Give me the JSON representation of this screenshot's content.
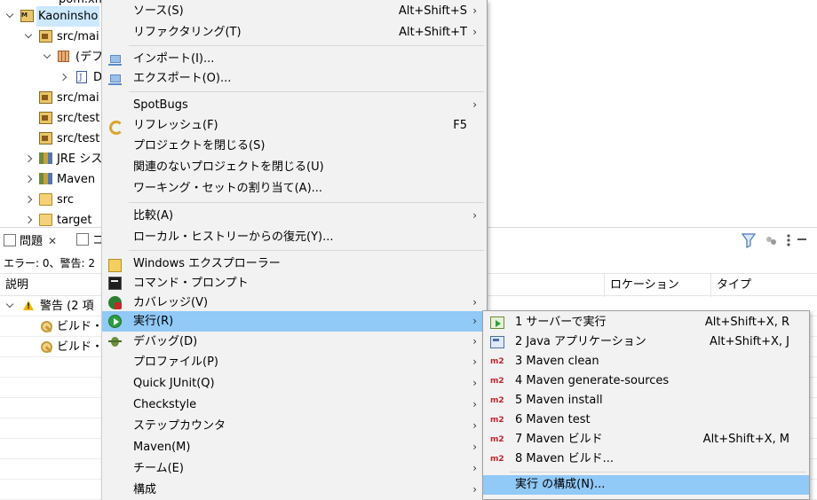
{
  "explorer": {
    "rows": [
      {
        "label": "pom.xml"
      },
      {
        "label": "Kaoninsho"
      },
      {
        "label": "src/mai"
      },
      {
        "label": "(デフ"
      },
      {
        "label": "D"
      },
      {
        "label": "src/mai"
      },
      {
        "label": "src/test"
      },
      {
        "label": "src/test"
      },
      {
        "label": "JRE シス"
      },
      {
        "label": "Maven"
      },
      {
        "label": "src"
      },
      {
        "label": "target"
      }
    ]
  },
  "problems_view": {
    "tab_label": "問題",
    "tab2_label": "コ",
    "summary": "エラー: 0、警告: 2",
    "columns": {
      "description": "説明",
      "location": "ロケーション",
      "type": "タイプ"
    },
    "group_label": "警告 (2 項",
    "rows": [
      {
        "label": "ビルド・パ"
      },
      {
        "label": "ビルド・パ"
      }
    ]
  },
  "context_menu": {
    "items": [
      {
        "label": "ソース(S)",
        "accel": "Alt+Shift+S",
        "submenu": true
      },
      {
        "label": "リファクタリング(T)",
        "accel": "Alt+Shift+T",
        "submenu": true
      },
      {
        "label": "インポート(I)...",
        "icon": "import-icon"
      },
      {
        "label": "エクスポート(O)...",
        "icon": "export-icon"
      },
      {
        "label": "SpotBugs",
        "submenu": true
      },
      {
        "label": "リフレッシュ(F)",
        "accel": "F5",
        "icon": "refresh-icon"
      },
      {
        "label": "プロジェクトを閉じる(S)"
      },
      {
        "label": "関連のないプロジェクトを閉じる(U)"
      },
      {
        "label": "ワーキング・セットの割り当て(A)..."
      },
      {
        "label": "比較(A)",
        "submenu": true
      },
      {
        "label": "ローカル・ヒストリーからの復元(Y)..."
      },
      {
        "label": "Windows エクスプローラー",
        "icon": "folder-icon"
      },
      {
        "label": "コマンド・プロンプト",
        "icon": "terminal-icon"
      },
      {
        "label": "カバレッジ(V)",
        "submenu": true,
        "icon": "coverage-icon"
      },
      {
        "label": "実行(R)",
        "submenu": true,
        "icon": "run-icon",
        "highlighted": true
      },
      {
        "label": "デバッグ(D)",
        "submenu": true,
        "icon": "debug-icon"
      },
      {
        "label": "プロファイル(P)",
        "submenu": true
      },
      {
        "label": "Quick JUnit(Q)",
        "submenu": true
      },
      {
        "label": "Checkstyle",
        "submenu": true
      },
      {
        "label": "ステップカウンタ",
        "submenu": true
      },
      {
        "label": "Maven(M)",
        "submenu": true
      },
      {
        "label": "チーム(E)",
        "submenu": true
      },
      {
        "label": "構成",
        "submenu": true
      }
    ]
  },
  "run_submenu": {
    "items": [
      {
        "label": "1 サーバーで実行",
        "accel": "Alt+Shift+X, R",
        "icon": "server-run-icon"
      },
      {
        "label": "2 Java アプリケーション",
        "accel": "Alt+Shift+X, J",
        "icon": "java-app-icon"
      },
      {
        "label": "3 Maven clean",
        "icon_text": "m2"
      },
      {
        "label": "4 Maven generate-sources",
        "icon_text": "m2"
      },
      {
        "label": "5 Maven install",
        "icon_text": "m2"
      },
      {
        "label": "6 Maven test",
        "icon_text": "m2"
      },
      {
        "label": "7 Maven ビルド",
        "accel": "Alt+Shift+X, M",
        "icon_text": "m2"
      },
      {
        "label": "8 Maven ビルド...",
        "icon_text": "m2"
      },
      {
        "label": "実行 の構成(N)...",
        "highlighted": true
      }
    ]
  },
  "colors": {
    "highlight": "#91c9f7",
    "menu_bg": "#f2f2f2",
    "maven_icon": "#c0262d"
  }
}
